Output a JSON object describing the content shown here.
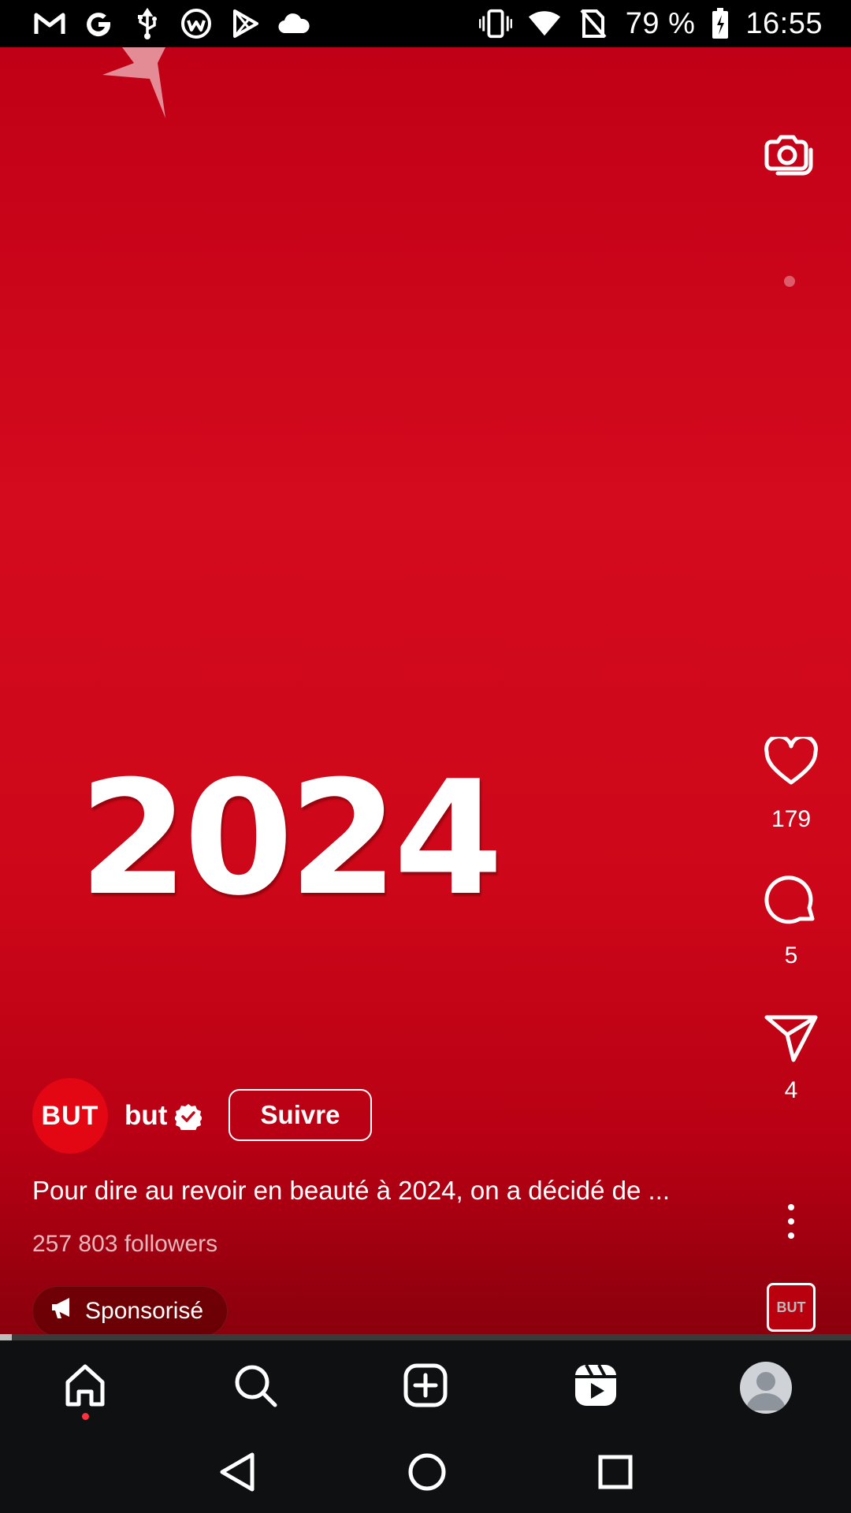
{
  "status_bar": {
    "battery_percent": "79 %",
    "time": "16:55",
    "left_icons": [
      "gmail-icon",
      "google-icon",
      "usb-icon",
      "app-icon",
      "play-store-icon",
      "cloud-icon"
    ],
    "right_icons": [
      "vibrate-icon",
      "wifi-icon",
      "no-sim-icon",
      "battery-icon"
    ]
  },
  "video": {
    "headline_text": "2024",
    "accent_color": "#d40a1e"
  },
  "actions": {
    "likes": "179",
    "comments": "5",
    "shares": "4"
  },
  "author": {
    "avatar_text": "BUT",
    "username": "but",
    "verified": true,
    "follow_label": "Suivre"
  },
  "caption": "Pour dire au revoir en beauté à 2024, on a décidé de ...",
  "followers": "257 803 followers",
  "sponsored_label": "Sponsorisé",
  "audio_thumb_text": "BUT",
  "progress": 0.014,
  "bottom_nav": [
    "home-icon",
    "search-icon",
    "create-icon",
    "reels-icon",
    "profile-icon"
  ],
  "system_nav": [
    "back-icon",
    "home-circle-icon",
    "recents-icon"
  ]
}
